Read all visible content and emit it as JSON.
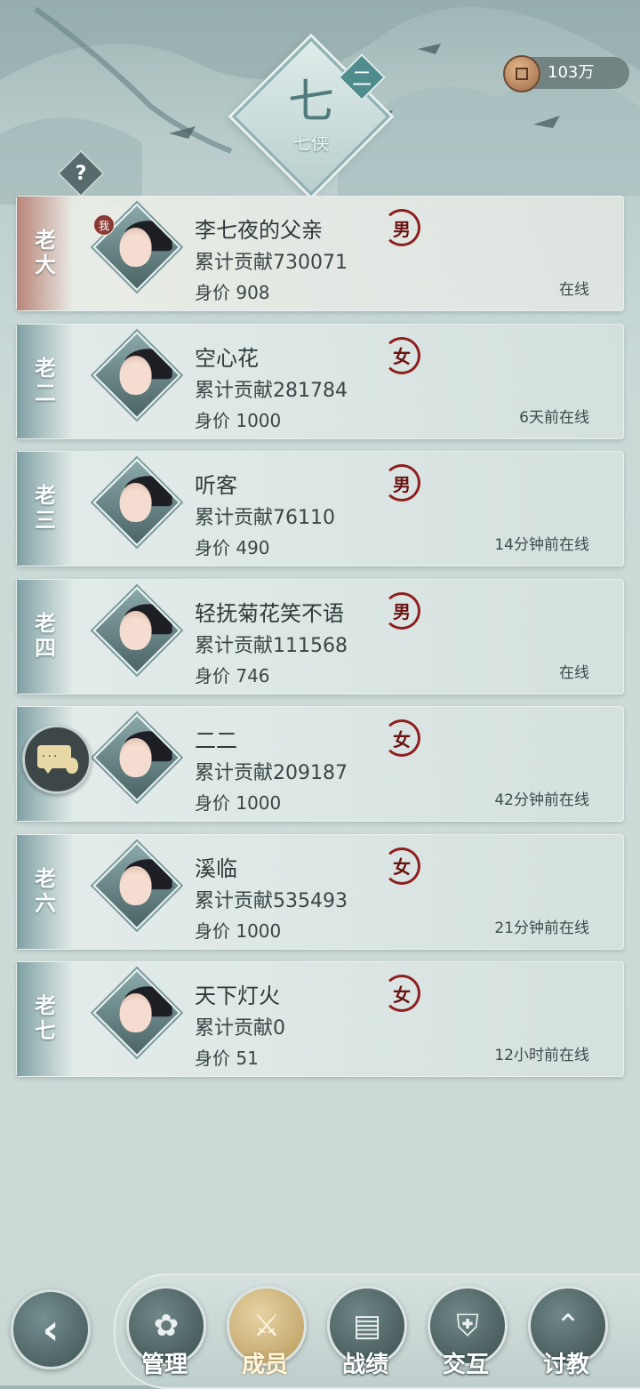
{
  "header": {
    "sect_emblem_glyph": "七",
    "sect_name": "七侠",
    "rank_badge": "二",
    "help_label": "?",
    "currency_value": "103万"
  },
  "members": [
    {
      "rank": "老大",
      "name": "李七夜的父亲",
      "gender": "男",
      "contribution": "累计贡献730071",
      "worth": "身价 908",
      "status": "在线",
      "me_tag": "我"
    },
    {
      "rank": "老二",
      "name": "空心花",
      "gender": "女",
      "contribution": "累计贡献281784",
      "worth": "身价 1000",
      "status": "6天前在线"
    },
    {
      "rank": "老三",
      "name": "听客",
      "gender": "男",
      "contribution": "累计贡献76110",
      "worth": "身价 490",
      "status": "14分钟前在线"
    },
    {
      "rank": "老四",
      "name": "轻抚菊花笑不语",
      "gender": "男",
      "contribution": "累计贡献111568",
      "worth": "身价 746",
      "status": "在线"
    },
    {
      "rank": "",
      "name": "二二",
      "gender": "女",
      "contribution": "累计贡献209187",
      "worth": "身价 1000",
      "status": "42分钟前在线"
    },
    {
      "rank": "老六",
      "name": "溪临",
      "gender": "女",
      "contribution": "累计贡献535493",
      "worth": "身价 1000",
      "status": "21分钟前在线"
    },
    {
      "rank": "老七",
      "name": "天下灯火",
      "gender": "女",
      "contribution": "累计贡献0",
      "worth": "身价 51",
      "status": "12小时前在线"
    }
  ],
  "nav": {
    "back_icon": "‹",
    "items": [
      {
        "label": "管理",
        "icon": "✿"
      },
      {
        "label": "成员",
        "icon": "⚔"
      },
      {
        "label": "战绩",
        "icon": "▤"
      },
      {
        "label": "交互",
        "icon": "⛨"
      },
      {
        "label": "讨教",
        "icon": "⌃"
      }
    ]
  }
}
